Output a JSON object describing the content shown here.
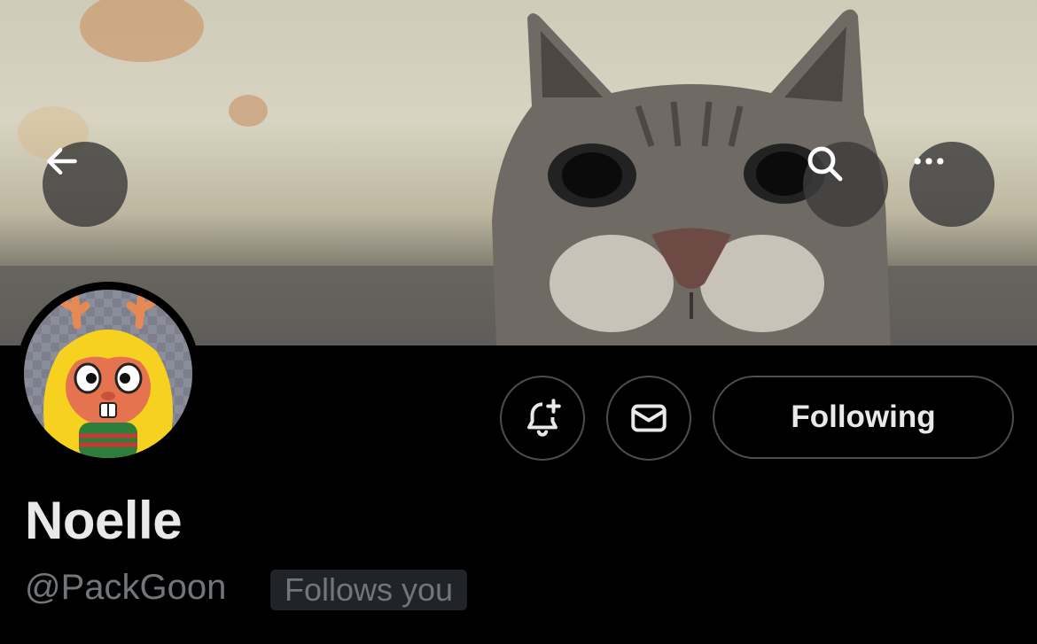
{
  "header": {
    "back_icon": "arrow-left-icon",
    "search_icon": "search-icon",
    "more_icon": "more-horizontal-icon"
  },
  "profile": {
    "display_name": "Noelle",
    "handle": "@PackGoon",
    "follows_you_label": "Follows you",
    "following_label": "Following",
    "notify_icon": "bell-plus-icon",
    "message_icon": "envelope-icon"
  },
  "colors": {
    "background": "#000000",
    "primary_text": "#e7e9ea",
    "secondary_text": "#71767b",
    "button_border": "#4a4d52",
    "badge_bg": "#202327"
  }
}
